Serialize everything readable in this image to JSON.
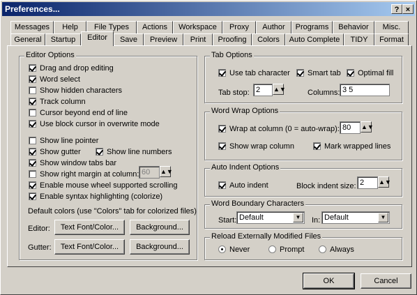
{
  "window": {
    "title": "Preferences...",
    "help_label": "?",
    "close_label": "×"
  },
  "tabs_row1": [
    "Messages",
    "Help",
    "File Types",
    "Actions",
    "Workspace",
    "Proxy",
    "Author",
    "Programs",
    "Behavior",
    "Misc."
  ],
  "tabs_row2": [
    "General",
    "Startup",
    "Editor",
    "Save",
    "Preview",
    "Print",
    "Proofing",
    "Colors",
    "Auto Complete",
    "TIDY",
    "Format"
  ],
  "selected_tab": "Editor",
  "editor_options": {
    "title": "Editor Options",
    "drag_drop": "Drag and drop editing",
    "word_select": "Word select",
    "show_hidden": "Show hidden characters",
    "track_column": "Track column",
    "cursor_beyond": "Cursor beyond end of line",
    "block_cursor": "Use block cursor in overwrite mode",
    "show_line_pointer": "Show line pointer",
    "show_gutter": "Show gutter",
    "show_line_numbers": "Show line numbers",
    "show_tabs_bar": "Show window tabs bar",
    "show_right_margin": "Show right margin at column:",
    "right_margin_value": "60",
    "mouse_wheel": "Enable mouse wheel supported scrolling",
    "syntax_highlight": "Enable syntax highlighting (colorize)",
    "default_colors": "Default colors (use \"Colors\" tab for colorized files)",
    "editor_label": "Editor:",
    "gutter_label": "Gutter:",
    "text_font_color": "Text Font/Color...",
    "background": "Background..."
  },
  "tab_options": {
    "title": "Tab Options",
    "use_tab_char": "Use tab character",
    "smart_tab": "Smart tab",
    "optimal_fill": "Optimal fill",
    "tab_stop_label": "Tab stop:",
    "tab_stop_value": "2",
    "columns_label": "Columns:",
    "columns_value": "3 5"
  },
  "word_wrap": {
    "title": "Word Wrap Options",
    "wrap_at": "Wrap at column (0 = auto-wrap):",
    "wrap_value": "80",
    "show_wrap_column": "Show wrap column",
    "mark_wrapped": "Mark wrapped lines"
  },
  "auto_indent": {
    "title": "Auto Indent Options",
    "auto_indent": "Auto indent",
    "block_indent_label": "Block indent size:",
    "block_indent_value": "2"
  },
  "word_boundary": {
    "title": "Word Boundary Characters",
    "start_label": "Start:",
    "start_value": "Default",
    "in_label": "In:",
    "in_value": "Default"
  },
  "reload": {
    "title": "Reload Externally Modified Files",
    "never": "Never",
    "prompt": "Prompt",
    "always": "Always"
  },
  "footer": {
    "ok": "OK",
    "cancel": "Cancel"
  },
  "icons": {
    "spin": "spin-arrows-icon",
    "dropdown": "dropdown-arrow-icon"
  }
}
